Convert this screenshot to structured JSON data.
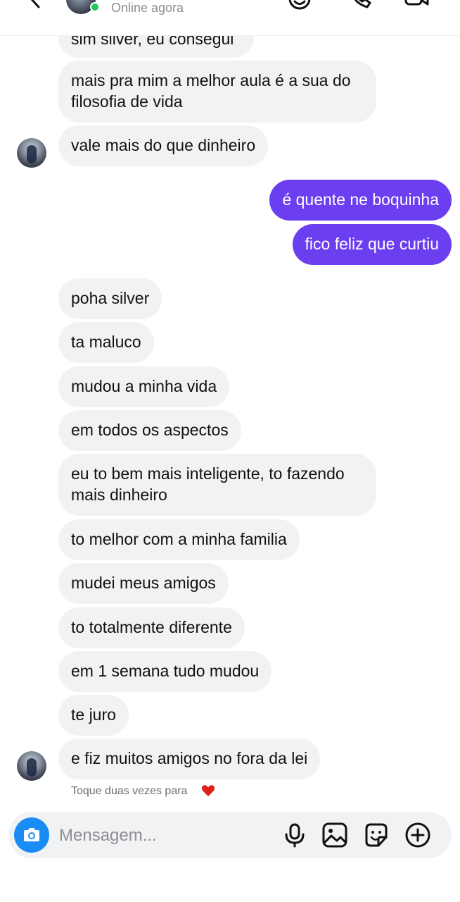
{
  "header": {
    "status": "Online agora",
    "icons": [
      "back-icon",
      "emoji-reaction-icon",
      "phone-icon",
      "video-icon"
    ]
  },
  "messages": [
    {
      "dir": "in",
      "text": "sim silver, eu consegui"
    },
    {
      "dir": "in",
      "text": "mais pra mim a melhor aula é a sua do filosofia de vida"
    },
    {
      "dir": "in",
      "text": "vale mais do que dinheiro"
    },
    {
      "dir": "out",
      "text": "é quente ne boquinha"
    },
    {
      "dir": "out",
      "text": "fico feliz que curtiu"
    },
    {
      "dir": "in",
      "text": "poha silver"
    },
    {
      "dir": "in",
      "text": "ta maluco"
    },
    {
      "dir": "in",
      "text": "mudou a minha vida"
    },
    {
      "dir": "in",
      "text": "em todos os aspectos"
    },
    {
      "dir": "in",
      "text": "eu to bem mais inteligente, to fazendo mais dinheiro"
    },
    {
      "dir": "in",
      "text": "to melhor com a minha familia"
    },
    {
      "dir": "in",
      "text": "mudei meus amigos"
    },
    {
      "dir": "in",
      "text": "to totalmente diferente"
    },
    {
      "dir": "in",
      "text": "em 1 semana tudo mudou"
    },
    {
      "dir": "in",
      "text": "te juro"
    },
    {
      "dir": "in",
      "text": "e fiz muitos amigos no fora da lei"
    }
  ],
  "hint": "Toque duas vezes para",
  "composer": {
    "placeholder": "Mensagem...",
    "icons": [
      "camera-icon",
      "microphone-icon",
      "gallery-icon",
      "sticker-icon",
      "plus-icon"
    ]
  },
  "colors": {
    "incoming_bubble": "#f1f2f4",
    "outgoing_bubble": "#6b3ef0",
    "camera_button": "#1a8cf5",
    "online_dot": "#22c55e"
  }
}
